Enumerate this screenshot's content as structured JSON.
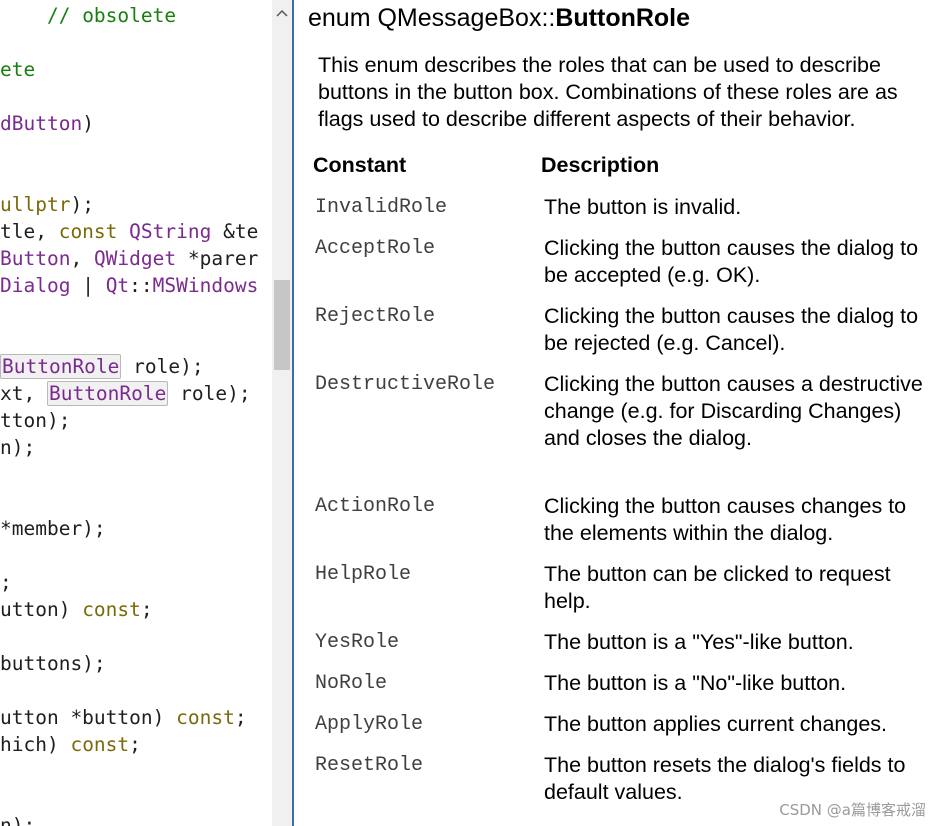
{
  "editor": {
    "lines": [
      [
        {
          "c": "tok-plain",
          "t": "    "
        },
        {
          "c": "tok-comment",
          "t": "// obsolete"
        }
      ],
      [],
      [
        {
          "c": "tok-comment",
          "t": "ete"
        }
      ],
      [],
      [
        {
          "c": "tok-type",
          "t": "dButton"
        },
        {
          "c": "tok-plain",
          "t": ")"
        }
      ],
      [],
      [],
      [
        {
          "c": "tok-keyword",
          "t": "ullptr"
        },
        {
          "c": "tok-plain",
          "t": ");"
        }
      ],
      [
        {
          "c": "tok-plain",
          "t": "tle, "
        },
        {
          "c": "tok-keyword",
          "t": "const"
        },
        {
          "c": "tok-plain",
          "t": " "
        },
        {
          "c": "tok-type",
          "t": "QString"
        },
        {
          "c": "tok-plain",
          "t": " &te"
        }
      ],
      [
        {
          "c": "tok-type",
          "t": "Button"
        },
        {
          "c": "tok-plain",
          "t": ", "
        },
        {
          "c": "tok-type",
          "t": "QWidget"
        },
        {
          "c": "tok-plain",
          "t": " *parer"
        }
      ],
      [
        {
          "c": "tok-type",
          "t": "Dialog"
        },
        {
          "c": "tok-plain",
          "t": " | "
        },
        {
          "c": "tok-type",
          "t": "Qt"
        },
        {
          "c": "tok-plain",
          "t": "::"
        },
        {
          "c": "tok-type",
          "t": "MSWindows"
        }
      ],
      [],
      [],
      [
        {
          "c": "tok-ref",
          "t": "ButtonRole"
        },
        {
          "c": "tok-plain",
          "t": " role);"
        }
      ],
      [
        {
          "c": "tok-plain",
          "t": "xt, "
        },
        {
          "c": "tok-ref",
          "t": "ButtonRole"
        },
        {
          "c": "tok-plain",
          "t": " role);"
        }
      ],
      [
        {
          "c": "tok-plain",
          "t": "tton);"
        }
      ],
      [
        {
          "c": "tok-plain",
          "t": "n);"
        }
      ],
      [],
      [],
      [
        {
          "c": "tok-plain",
          "t": "*member);"
        }
      ],
      [],
      [
        {
          "c": "tok-plain",
          "t": ";"
        }
      ],
      [
        {
          "c": "tok-plain",
          "t": "utton) "
        },
        {
          "c": "tok-keyword",
          "t": "const"
        },
        {
          "c": "tok-plain",
          "t": ";"
        }
      ],
      [],
      [
        {
          "c": "tok-plain",
          "t": "buttons);"
        }
      ],
      [],
      [
        {
          "c": "tok-plain",
          "t": "utton *button) "
        },
        {
          "c": "tok-keyword",
          "t": "const"
        },
        {
          "c": "tok-plain",
          "t": ";"
        }
      ],
      [
        {
          "c": "tok-plain",
          "t": "hich) "
        },
        {
          "c": "tok-keyword",
          "t": "const"
        },
        {
          "c": "tok-plain",
          "t": ";"
        }
      ],
      [],
      [],
      [
        {
          "c": "tok-plain",
          "t": "n);"
        }
      ]
    ]
  },
  "help": {
    "title_prefix": "enum QMessageBox::",
    "title_name": "ButtonRole",
    "description": "This enum describes the roles that can be used to describe buttons in the button box. Combinations of these roles are as flags used to describe different aspects of their behavior.",
    "col_constant": "Constant",
    "col_description": "Description",
    "rows": [
      {
        "constant": "InvalidRole",
        "description": "The button is invalid."
      },
      {
        "constant": "AcceptRole",
        "description": "Clicking the button causes the dialog to be accepted (e.g. OK)."
      },
      {
        "constant": "RejectRole",
        "description": "Clicking the button causes the dialog to be rejected (e.g. Cancel)."
      },
      {
        "constant": "DestructiveRole",
        "description": "Clicking the button causes a destructive change (e.g. for Discarding Changes) and closes the dialog."
      },
      {
        "constant": "ActionRole",
        "description": "Clicking the button causes changes to the elements within the dialog."
      },
      {
        "constant": "HelpRole",
        "description": "The button can be clicked to request help."
      },
      {
        "constant": "YesRole",
        "description": "The button is a \"Yes\"-like button."
      },
      {
        "constant": "NoRole",
        "description": "The button is a \"No\"-like button."
      },
      {
        "constant": "ApplyRole",
        "description": "The button applies current changes."
      },
      {
        "constant": "ResetRole",
        "description": "The button resets the dialog's fields to default values."
      }
    ]
  },
  "watermark": "CSDN @a篇博客戒溜"
}
